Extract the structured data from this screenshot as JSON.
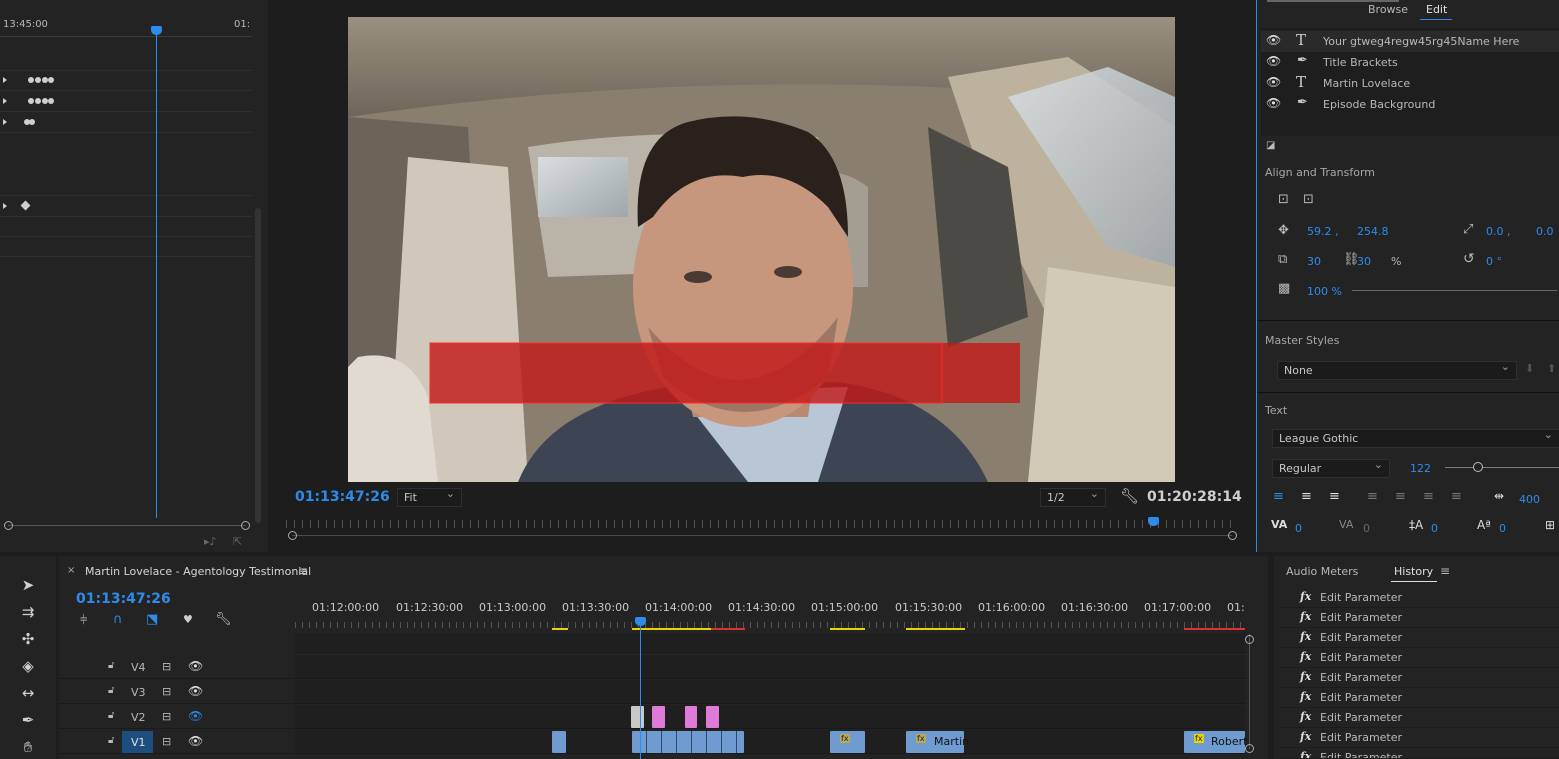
{
  "effect_controls": {
    "time_start": "13:45:00",
    "time_end": "01:"
  },
  "program_monitor": {
    "current_time": "01:13:47:26",
    "zoom": "Fit",
    "resolution": "1/2",
    "duration": "01:20:28:14"
  },
  "essential_graphics": {
    "tabs": [
      "Browse",
      "Edit"
    ],
    "active_tab": "Edit",
    "layers": [
      {
        "type": "text",
        "name": "Your gtweg4regw45rg45Name Here"
      },
      {
        "type": "shape",
        "name": "Title Brackets"
      },
      {
        "type": "text",
        "name": "Martin Lovelace"
      },
      {
        "type": "shape",
        "name": "Episode Background"
      }
    ],
    "align_section": "Align and Transform",
    "position_x": "59.2 ,",
    "position_y": "254.8",
    "anchor_x": "0.0 ,",
    "anchor_y": "0.0",
    "scale_w": "30",
    "scale_h": "30",
    "scale_unit": "%",
    "rotation": "0 °",
    "opacity": "100 %",
    "master_styles_label": "Master Styles",
    "master_style_value": "None",
    "text_label": "Text",
    "font": "League Gothic",
    "font_style": "Regular",
    "font_size": "122",
    "tracking": "400",
    "kerning": "0",
    "leading": "0",
    "baseline": "0",
    "tsume": "0"
  },
  "timeline": {
    "sequence_name": "Martin Lovelace - Agentology Testimonial",
    "current_time": "01:13:47:26",
    "ruler_labels": [
      "01:12:00:00",
      "01:12:30:00",
      "01:13:00:00",
      "01:13:30:00",
      "01:14:00:00",
      "01:14:30:00",
      "01:15:00:00",
      "01:15:30:00",
      "01:16:00:00",
      "01:16:30:00",
      "01:17:00:00",
      "01:"
    ],
    "tracks": [
      "V4",
      "V3",
      "V2",
      "V1"
    ],
    "clip_labels": [
      "Martin",
      "Robert"
    ]
  },
  "history_panel": {
    "tabs": [
      "Audio Meters",
      "History"
    ],
    "active_tab": "History",
    "items": [
      "Edit Parameter",
      "Edit Parameter",
      "Edit Parameter",
      "Edit Parameter",
      "Edit Parameter",
      "Edit Parameter",
      "Edit Parameter",
      "Edit Parameter",
      "Edit Parameter"
    ]
  },
  "colors": {
    "accent": "#2d8ceb",
    "clip_blue": "#6f9bd1",
    "clip_pink": "#e07ad8",
    "warn_yellow": "#e8d400",
    "warn_red": "#e03030",
    "title_bar_red": "#c21a1a"
  }
}
